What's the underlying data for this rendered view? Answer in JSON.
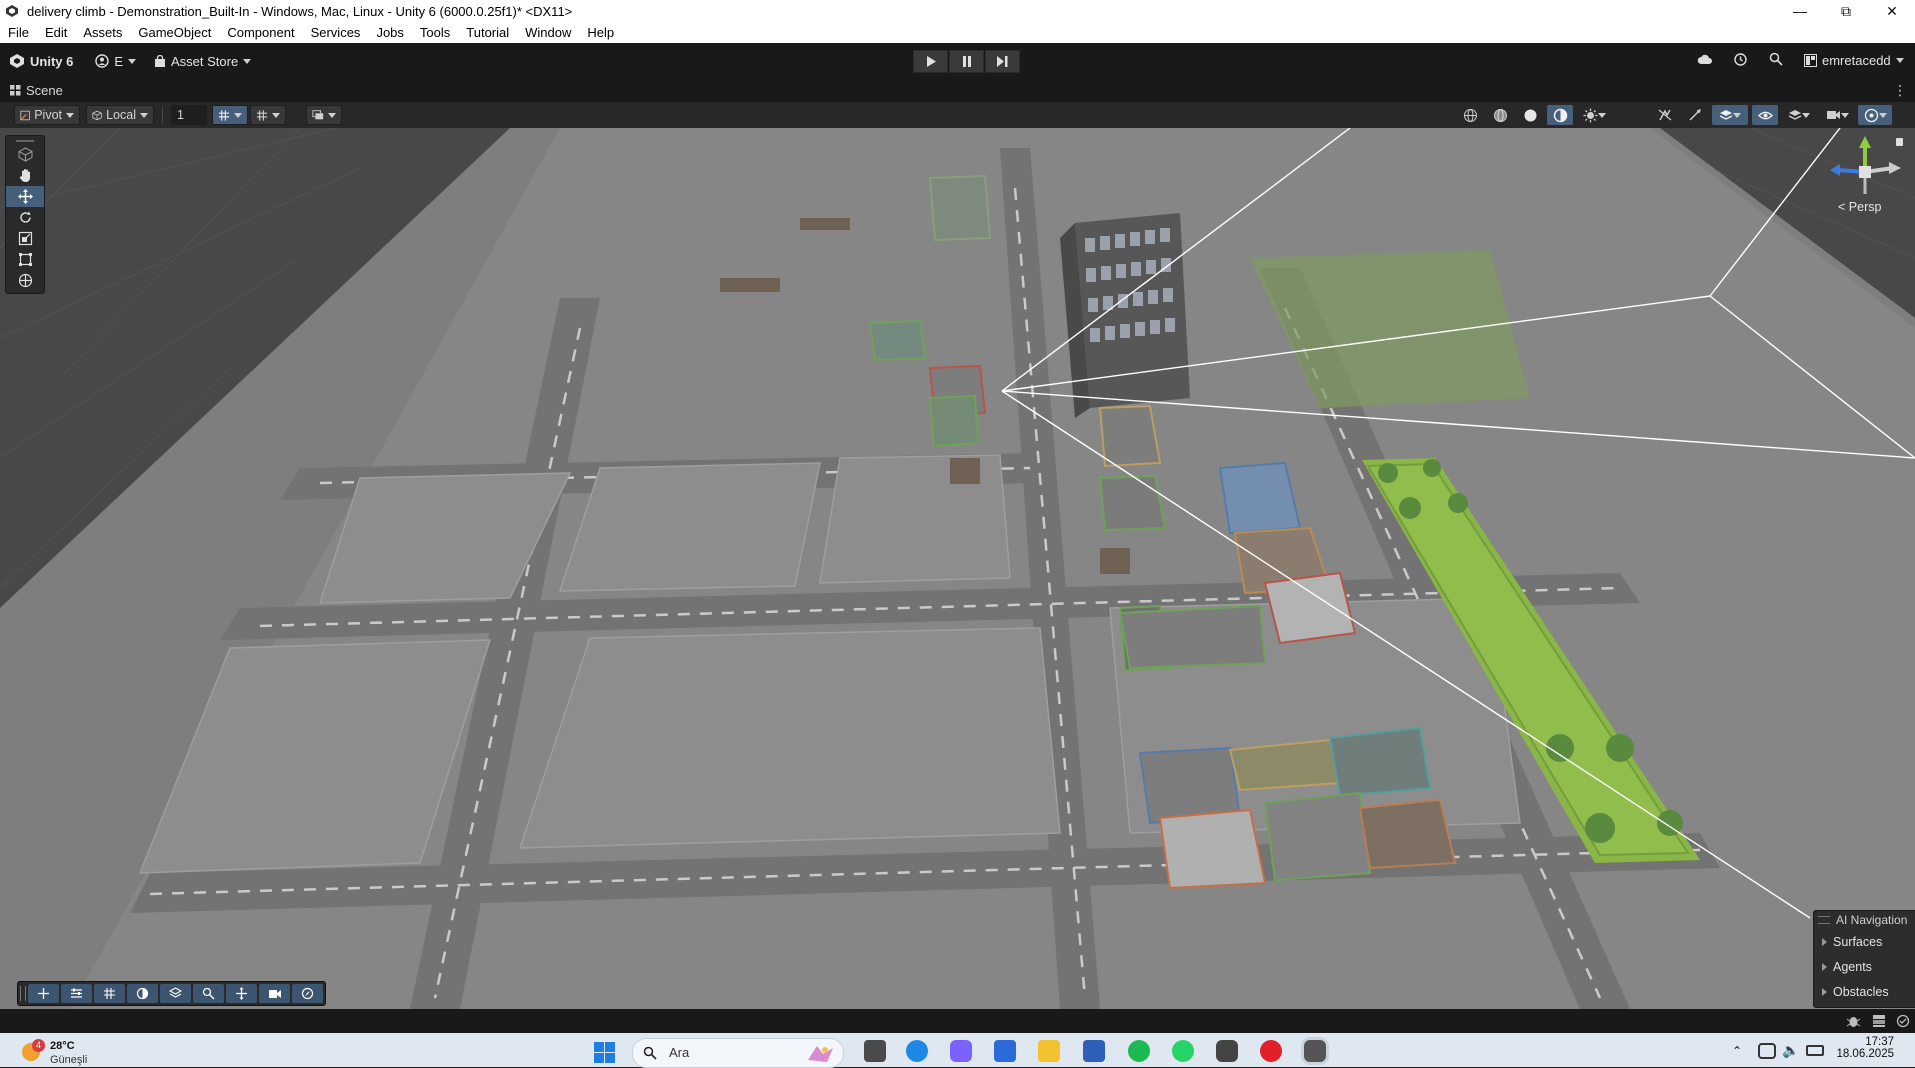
{
  "window": {
    "title": "delivery climb - Demonstration_Built-In - Windows, Mac, Linux - Unity 6 (6000.0.25f1)* <DX11>",
    "controls": [
      "minimize",
      "maximize",
      "close"
    ]
  },
  "menu": [
    "File",
    "Edit",
    "Assets",
    "GameObject",
    "Component",
    "Services",
    "Jobs",
    "Tools",
    "Tutorial",
    "Window",
    "Help"
  ],
  "toolbar": {
    "brand": "Unity 6",
    "account_initial": "E",
    "asset_store": "Asset Store",
    "user": "emretacedd"
  },
  "scene_tab": {
    "label": "Scene"
  },
  "scene_toolbar": {
    "pivot": "Pivot",
    "space": "Local",
    "grid_size": "1"
  },
  "viewport": {
    "camera_mode": "Persp",
    "camera_mode_prefix": "<"
  },
  "ai_navigation": {
    "title": "AI Navigation",
    "items": [
      "Surfaces",
      "Agents",
      "Obstacles"
    ]
  },
  "taskbar": {
    "weather_temp": "28°C",
    "weather_desc": "Güneşli",
    "weather_badge": "4",
    "search_placeholder": "Ara",
    "time": "17:37",
    "date": "18.06.2025"
  },
  "colors": {
    "unity_dark": "#191919",
    "scene_toolbar": "#282828",
    "active_tool": "#46607c",
    "park_green": "#8ac03a",
    "taskbar_bg": "#dfe7f0"
  }
}
